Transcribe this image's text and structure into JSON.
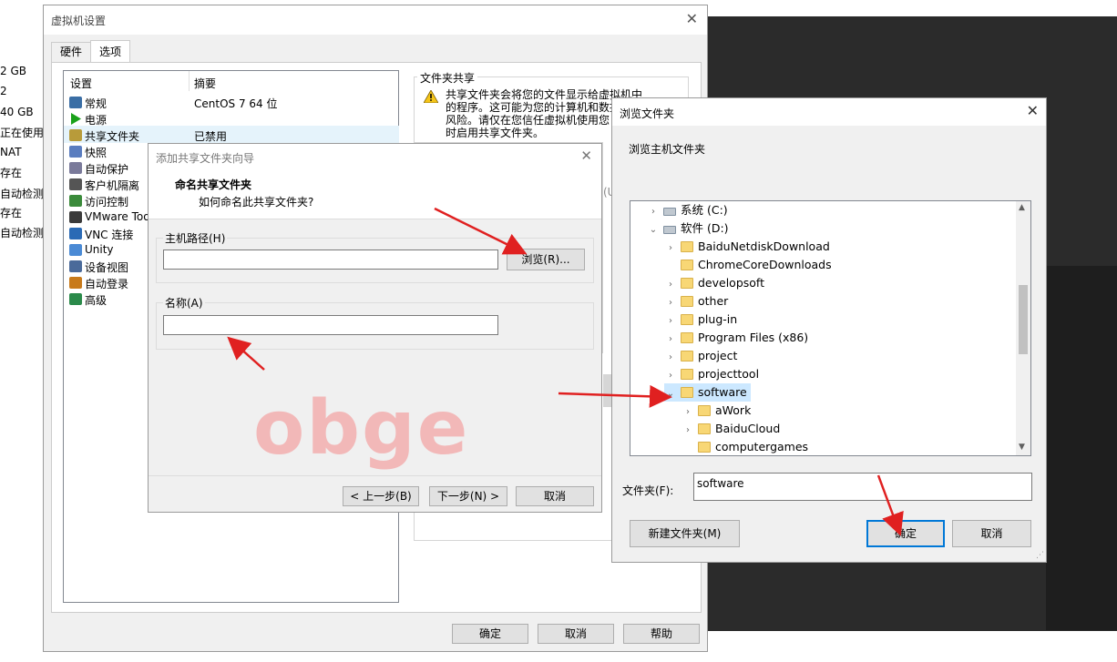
{
  "background_left": [
    "2 GB",
    "2",
    "40 GB",
    "正在使用文",
    "NAT",
    "存在",
    "自动检测",
    "存在",
    "自动检测"
  ],
  "vm_settings": {
    "title": "虚拟机设置",
    "tabs": [
      "硬件",
      "选项"
    ],
    "table_headers": [
      "设置",
      "摘要"
    ],
    "items": [
      {
        "label": "常规",
        "summary": "CentOS 7 64 位",
        "icon": "monitor-icon"
      },
      {
        "label": "电源",
        "summary": "",
        "icon": "power-play-icon"
      },
      {
        "label": "共享文件夹",
        "summary": "已禁用",
        "icon": "shared-folder-icon"
      },
      {
        "label": "快照",
        "summary": "",
        "icon": "snapshot-icon"
      },
      {
        "label": "自动保护",
        "summary": "",
        "icon": "autoprotect-icon"
      },
      {
        "label": "客户机隔离",
        "summary": "",
        "icon": "lock-icon"
      },
      {
        "label": "访问控制",
        "summary": "",
        "icon": "access-control-icon"
      },
      {
        "label": "VMware Tools",
        "summary": "",
        "icon": "vmware-tools-icon"
      },
      {
        "label": "VNC 连接",
        "summary": "",
        "icon": "vnc-icon"
      },
      {
        "label": "Unity",
        "summary": "",
        "icon": "unity-icon"
      },
      {
        "label": "设备视图",
        "summary": "",
        "icon": "device-view-icon"
      },
      {
        "label": "自动登录",
        "summary": "",
        "icon": "autologin-icon"
      },
      {
        "label": "高级",
        "summary": "",
        "icon": "advanced-icon"
      }
    ],
    "shared_section_title": "文件夹共享",
    "warning_text": [
      "共享文件夹会将您的文件显示给虚拟机中",
      "的程序。这可能为您的计算机和数据",
      "风险。请仅在您信任虚拟机使用您",
      "时启用共享文件夹。"
    ],
    "right_fragment": "(U",
    "buttons": {
      "ok": "确定",
      "cancel": "取消",
      "help": "帮助"
    }
  },
  "wizard": {
    "title": "添加共享文件夹向导",
    "heading": "命名共享文件夹",
    "subheading": "如何命名此共享文件夹?",
    "host_path_label": "主机路径(H)",
    "host_path_value": "",
    "browse_button": "浏览(R)...",
    "name_label": "名称(A)",
    "name_value": "",
    "watermark": "obge",
    "buttons": {
      "back": "< 上一步(B)",
      "next": "下一步(N) >",
      "cancel": "取消"
    }
  },
  "browse": {
    "title": "浏览文件夹",
    "instruction": "浏览主机文件夹",
    "tree": [
      {
        "label": "系统 (C:)",
        "level": 0,
        "expander": ">",
        "icon": "drive-c-icon"
      },
      {
        "label": "软件 (D:)",
        "level": 0,
        "expander": "v",
        "icon": "drive-d-icon"
      },
      {
        "label": "BaiduNetdiskDownload",
        "level": 1,
        "expander": ">",
        "icon": "folder-icon"
      },
      {
        "label": "ChromeCoreDownloads",
        "level": 1,
        "expander": "",
        "icon": "folder-icon"
      },
      {
        "label": "developsoft",
        "level": 1,
        "expander": ">",
        "icon": "folder-icon"
      },
      {
        "label": "other",
        "level": 1,
        "expander": ">",
        "icon": "folder-icon"
      },
      {
        "label": "plug-in",
        "level": 1,
        "expander": ">",
        "icon": "folder-icon"
      },
      {
        "label": "Program Files (x86)",
        "level": 1,
        "expander": ">",
        "icon": "folder-icon"
      },
      {
        "label": "project",
        "level": 1,
        "expander": ">",
        "icon": "folder-icon"
      },
      {
        "label": "projecttool",
        "level": 1,
        "expander": ">",
        "icon": "folder-icon"
      },
      {
        "label": "software",
        "level": 1,
        "expander": "v",
        "icon": "folder-icon",
        "selected": true
      },
      {
        "label": "aWork",
        "level": 2,
        "expander": ">",
        "icon": "folder-icon"
      },
      {
        "label": "BaiduCloud",
        "level": 2,
        "expander": ">",
        "icon": "folder-icon"
      },
      {
        "label": "computergames",
        "level": 2,
        "expander": "",
        "icon": "folder-icon"
      }
    ],
    "folder_label": "文件夹(F):",
    "folder_value": "software",
    "new_folder_button": "新建文件夹(M)",
    "ok_button": "确定",
    "cancel_button": "取消"
  },
  "colors": {
    "selection": "#cce8ff",
    "accent": "#0078d7",
    "annotation_arrow": "#e02020",
    "watermark": "#f2b8b8"
  }
}
